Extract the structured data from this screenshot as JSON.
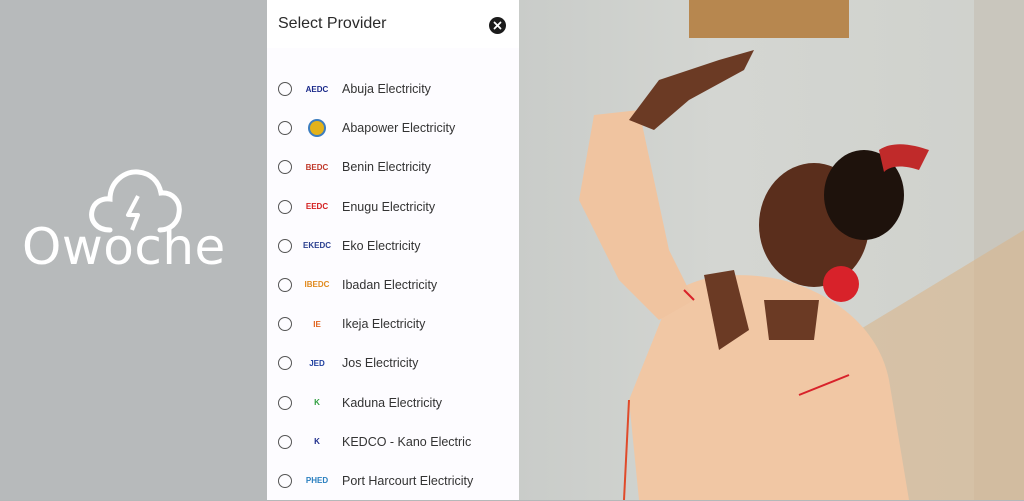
{
  "brand": {
    "name": "Owoche"
  },
  "sheet": {
    "title": "Select Provider",
    "close_icon": "close-icon"
  },
  "providers": [
    {
      "label": "Abuja Electricity",
      "logo_text": "AEDC",
      "logo_color": "#1b2a8a"
    },
    {
      "label": "Abapower Electricity",
      "logo_text": "",
      "logo_color": "#e3b21a"
    },
    {
      "label": "Benin Electricity",
      "logo_text": "BEDC",
      "logo_color": "#c0392b"
    },
    {
      "label": "Enugu Electricity",
      "logo_text": "EEDC",
      "logo_color": "#d42020"
    },
    {
      "label": "Eko Electricity",
      "logo_text": "EKEDC",
      "logo_color": "#2a3f8f"
    },
    {
      "label": "Ibadan Electricity",
      "logo_text": "IBEDC",
      "logo_color": "#e08a1e"
    },
    {
      "label": "Ikeja Electricity",
      "logo_text": "IE",
      "logo_color": "#e0641e"
    },
    {
      "label": "Jos Electricity",
      "logo_text": "JED",
      "logo_color": "#2040a0"
    },
    {
      "label": "Kaduna Electricity",
      "logo_text": "K",
      "logo_color": "#2e9e3e"
    },
    {
      "label": "KEDCO - Kano Electric",
      "logo_text": "K",
      "logo_color": "#1b2a8a"
    },
    {
      "label": "Port Harcourt Electricity",
      "logo_text": "PHED",
      "logo_color": "#2a7fbf"
    }
  ]
}
